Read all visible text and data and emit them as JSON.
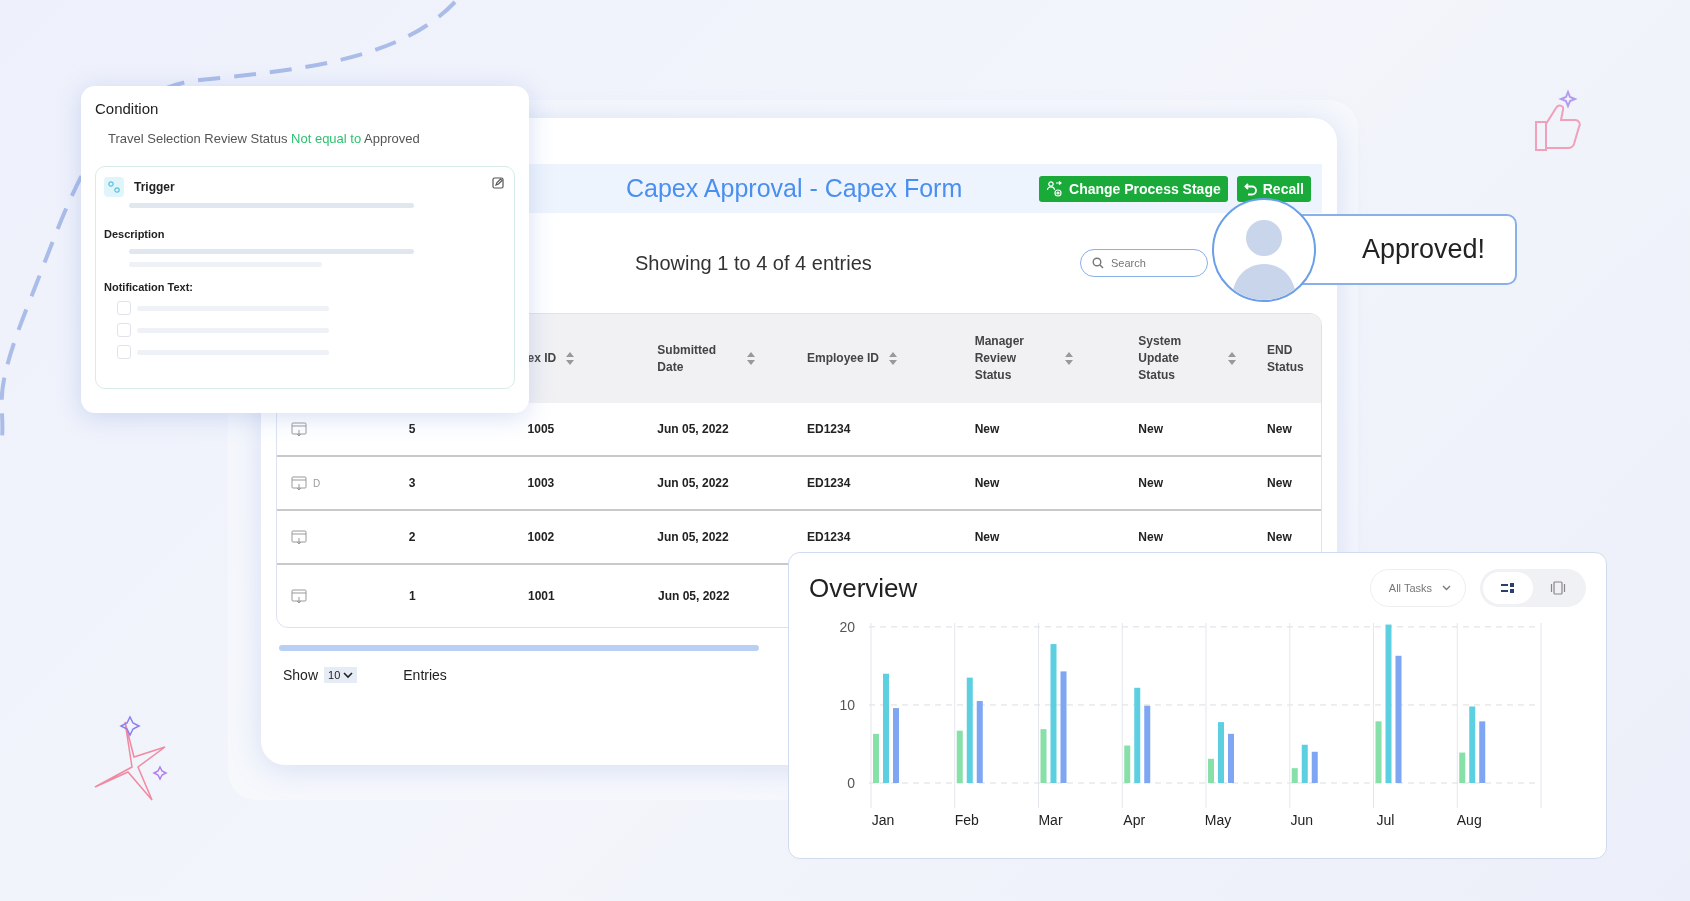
{
  "condition_card": {
    "title": "Condition",
    "condition": {
      "field": "Travel Selection Review Status",
      "operator": "Not equal to",
      "value": "Approved"
    },
    "trigger_label": "Trigger",
    "description_label": "Description",
    "notification_label": "Notification Text:",
    "notification_options": [
      {
        "checked": false
      },
      {
        "checked": false
      },
      {
        "checked": false
      }
    ]
  },
  "form": {
    "title": "Capex Approval - Capex Form",
    "buttons": [
      {
        "label": "Change Process Stage",
        "kind": "stage"
      },
      {
        "label": "Recall",
        "kind": "recall"
      }
    ],
    "entries_info": "Showing 1 to 4 of 4 entries",
    "search": {
      "placeholder": "Search"
    },
    "table": {
      "columns": [
        "",
        "",
        "ex ID",
        "Submitted Date",
        "Employee ID",
        "Manager Review Status",
        "System Update Status",
        "END Status"
      ],
      "rows": [
        {
          "cells": [
            "",
            "5",
            "1005",
            "Jun 05, 2022",
            "ED1234",
            "New",
            "New",
            "New"
          ]
        },
        {
          "cells": [
            "D",
            "3",
            "1003",
            "Jun 05, 2022",
            "ED1234",
            "New",
            "New",
            "New"
          ]
        },
        {
          "cells": [
            "",
            "2",
            "1002",
            "Jun 05, 2022",
            "ED1234",
            "New",
            "New",
            "New"
          ]
        },
        {
          "cells": [
            "",
            "1",
            "1001",
            "Jun 05, 2022"
          ]
        }
      ]
    },
    "show_label": "Show",
    "page_size": "10",
    "entries_label": "Entries"
  },
  "approval_badge": {
    "text": "Approved!"
  },
  "overview": {
    "title": "Overview",
    "filter": "All Tasks",
    "view_toggle": [
      {
        "selected": true
      },
      {
        "selected": false
      }
    ],
    "chart_data": {
      "type": "bar",
      "categories": [
        "Jan",
        "Feb",
        "Mar",
        "Apr",
        "May",
        "Jun",
        "Jul",
        "Aug"
      ],
      "ylim": [
        0,
        20.5
      ],
      "yticks": [
        0,
        10,
        20
      ],
      "series": [
        {
          "color": "#86e0a8",
          "values": [
            6.3,
            6.7,
            6.9,
            4.8,
            3.1,
            1.9,
            7.9,
            3.9
          ]
        },
        {
          "color": "#5ccfe0",
          "values": [
            14,
            13.5,
            17.8,
            12.2,
            7.8,
            4.9,
            20.3,
            9.8
          ]
        },
        {
          "color": "#7ea6f2",
          "values": [
            9.6,
            10.5,
            14.3,
            9.9,
            6.3,
            4,
            16.3,
            7.9
          ]
        }
      ]
    }
  }
}
